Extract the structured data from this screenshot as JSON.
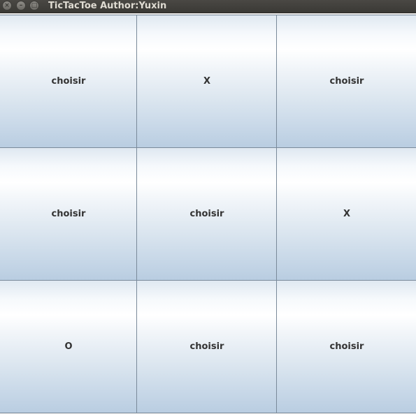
{
  "window": {
    "title": "TicTacToe Author:Yuxin",
    "controls": [
      "close-icon",
      "minimize-icon",
      "maximize-icon"
    ]
  },
  "board": {
    "cells": [
      {
        "row": 1,
        "col": 1,
        "label": "choisir"
      },
      {
        "row": 1,
        "col": 2,
        "label": "X"
      },
      {
        "row": 1,
        "col": 3,
        "label": "choisir"
      },
      {
        "row": 2,
        "col": 1,
        "label": "choisir"
      },
      {
        "row": 2,
        "col": 2,
        "label": "choisir"
      },
      {
        "row": 2,
        "col": 3,
        "label": "X"
      },
      {
        "row": 3,
        "col": 1,
        "label": "O"
      },
      {
        "row": 3,
        "col": 2,
        "label": "choisir"
      },
      {
        "row": 3,
        "col": 3,
        "label": "choisir"
      }
    ]
  },
  "colors": {
    "titlebar": "#3f3e3a",
    "title_text": "#dfdbd2",
    "cell_border": "#7a8a9a",
    "cell_text": "#333333"
  }
}
